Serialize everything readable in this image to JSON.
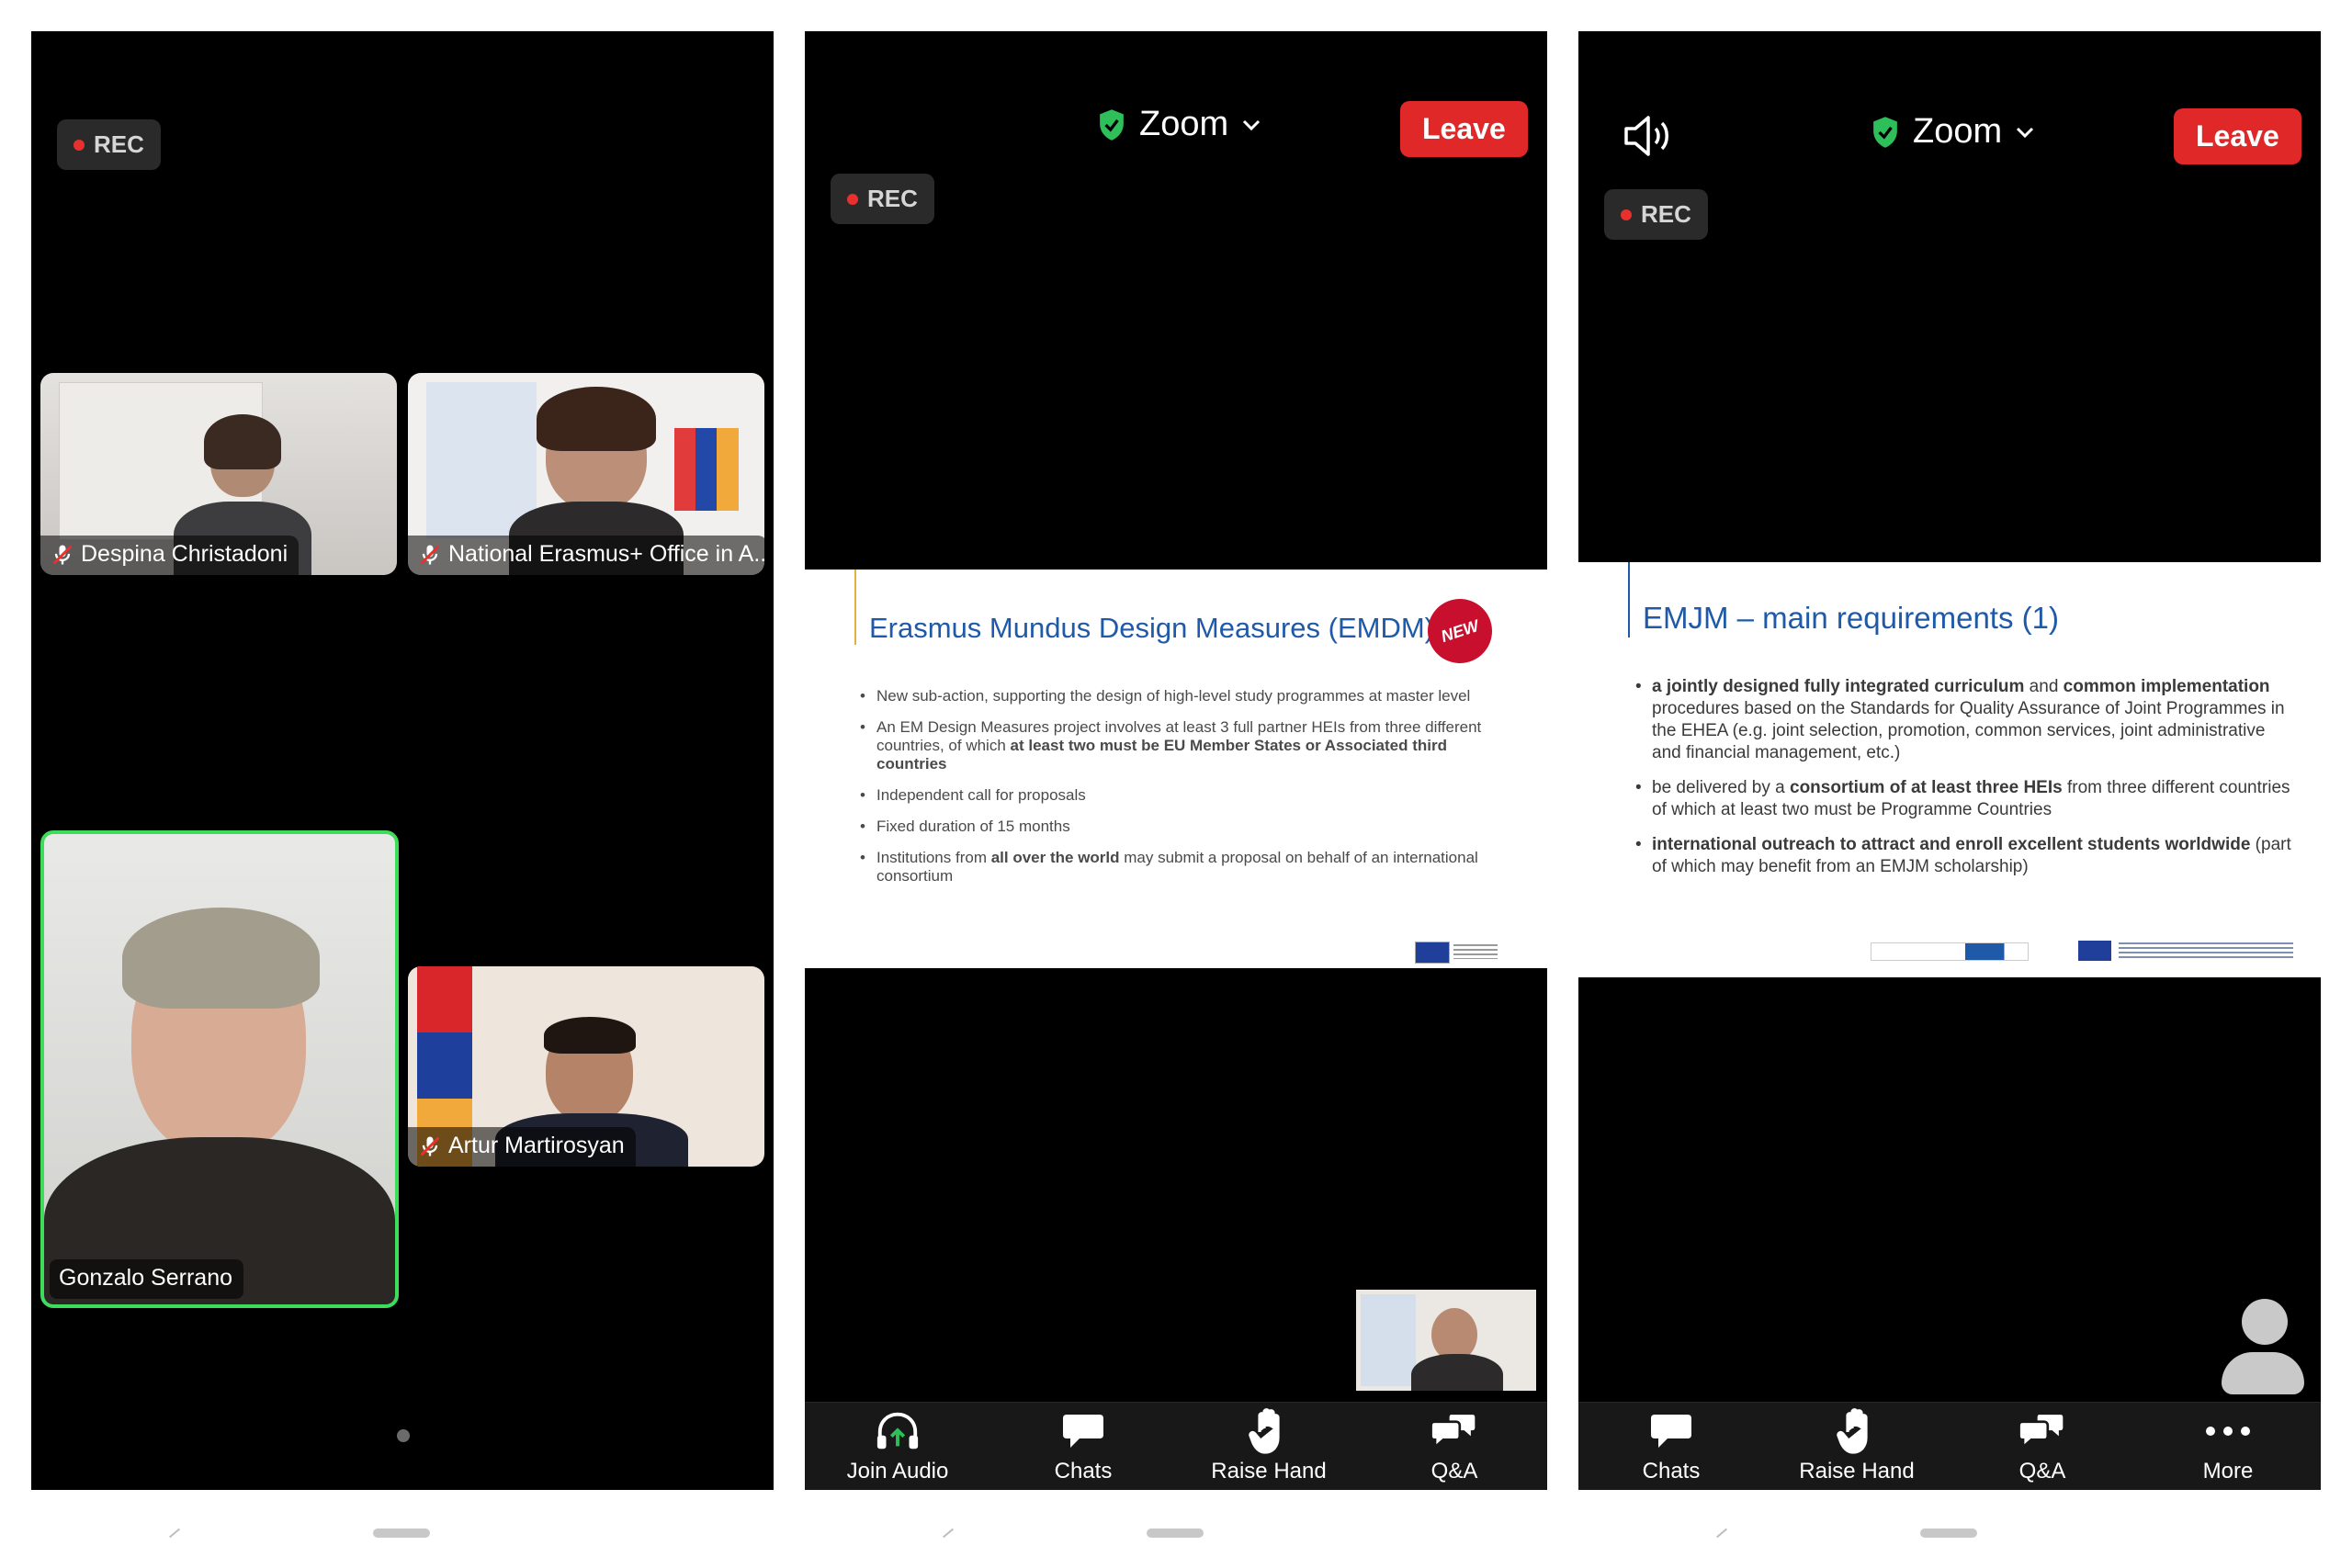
{
  "panel1": {
    "rec": "REC",
    "participants": [
      {
        "name": "Despina Christadoni"
      },
      {
        "name": "National Erasmus+ Office in A..."
      },
      {
        "name": "Gonzalo Serrano"
      },
      {
        "name": "Artur Martirosyan"
      }
    ],
    "active_border_color": "#3ddc5a"
  },
  "panel2": {
    "title": "Zoom",
    "leave": "Leave",
    "rec": "REC",
    "slide": {
      "title": "Erasmus Mundus Design Measures (EMDM)",
      "badge": "NEW",
      "bullets": [
        {
          "parts": [
            "New sub-action, supporting the design of high-level study programmes at master level"
          ]
        },
        {
          "text": "An EM Design Measures project involves at least 3 full partner HEIs from three different countries, of which ",
          "bold": "at least two must be EU Member States or Associated third countries"
        },
        {
          "parts": [
            "Independent call for proposals"
          ]
        },
        {
          "parts": [
            "Fixed duration of 15 months"
          ]
        },
        {
          "text": "Institutions from ",
          "bold": "all over the world",
          "tail": " may submit a proposal on behalf of an international consortium"
        }
      ]
    },
    "toolbar": [
      "Join Audio",
      "Chats",
      "Raise Hand",
      "Q&A"
    ]
  },
  "panel3": {
    "title": "Zoom",
    "leave": "Leave",
    "rec": "REC",
    "slide": {
      "title": "EMJM – main requirements (1)",
      "b1": {
        "bold1": "a jointly designed fully integrated curriculum",
        "mid": " and ",
        "bold2": "common implementation",
        "tail": " procedures based on the Standards for Quality Assurance of Joint Programmes in the EHEA (e.g. joint selection, promotion, common services, joint administrative and financial management, etc.)"
      },
      "b2": {
        "text": "be delivered by a ",
        "bold": "consortium of at least three HEIs",
        "tail": " from three different countries of which at least two must be Programme Countries"
      },
      "b3": {
        "bold": "international outreach to attract and enroll excellent students worldwide",
        "tail": " (part of which may benefit from an EMJM scholarship)"
      }
    },
    "toolbar": [
      "Chats",
      "Raise Hand",
      "Q&A",
      "More"
    ]
  },
  "colors": {
    "leave": "#e02828",
    "shield": "#2fbf5a",
    "slide_title": "#1f5aa8"
  }
}
